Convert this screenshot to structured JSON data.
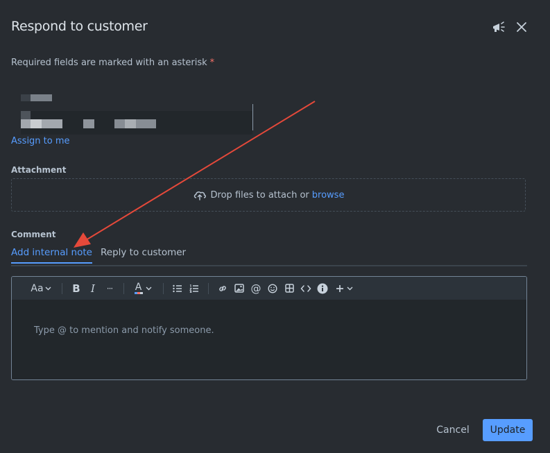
{
  "dialog": {
    "title": "Respond to customer",
    "header_icons": [
      "megaphone-icon",
      "close-icon"
    ]
  },
  "form": {
    "required_note": "Required fields are marked with an asterisk",
    "required_marker": "*",
    "assign_link": "Assign to me",
    "attachment": {
      "label": "Attachment",
      "drop_text": "Drop files to attach or",
      "browse_link": "browse"
    },
    "comment": {
      "label": "Comment",
      "tabs": [
        {
          "label": "Add internal note",
          "active": true
        },
        {
          "label": "Reply to customer",
          "active": false
        }
      ],
      "toolbar": {
        "text_style": "Aa",
        "bold": "B",
        "italic": "I",
        "more": "···",
        "text_color": "A"
      },
      "placeholder": "Type @ to mention and notify someone."
    }
  },
  "footer": {
    "cancel_label": "Cancel",
    "update_label": "Update"
  },
  "colors": {
    "background": "#282c31",
    "link": "#579dff",
    "primary_button": "#579dff",
    "asterisk": "#f87168",
    "annotation_arrow": "#e5493a"
  }
}
